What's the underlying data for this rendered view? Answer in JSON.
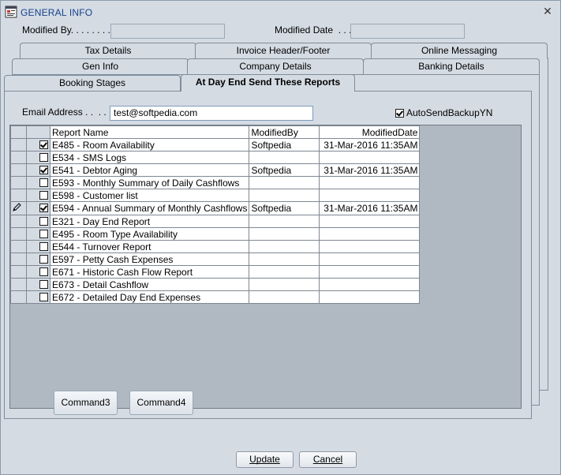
{
  "window": {
    "title": "GENERAL INFO"
  },
  "header": {
    "modified_by_label": "Modified By. . . . . . . . . .",
    "modified_by_value": "",
    "modified_date_label": "Modified Date  . . . .",
    "modified_date_value": ""
  },
  "tabs": {
    "row1": [
      "Tax Details",
      "Invoice Header/Footer",
      "Online Messaging"
    ],
    "row2": [
      "Gen Info",
      "Company Details",
      "Banking Details"
    ],
    "row3": [
      "Booking Stages",
      "At Day End Send These Reports"
    ],
    "active": "At Day End Send These Reports"
  },
  "form": {
    "email_label": "Email Address . .  . . . . .",
    "email_value": "test@softpedia.com",
    "autosend_label": "AutoSendBackupYN",
    "autosend_checked": true
  },
  "grid": {
    "columns": [
      "Report Name",
      "ModifiedBy",
      "ModifiedDate"
    ],
    "rows": [
      {
        "checked": true,
        "name": "E485 - Room Availability",
        "by": "Softpedia",
        "date": "31-Mar-2016 11:35AM"
      },
      {
        "checked": false,
        "name": "E534 - SMS Logs",
        "by": "",
        "date": ""
      },
      {
        "checked": true,
        "name": "E541 - Debtor Aging",
        "by": "Softpedia",
        "date": "31-Mar-2016 11:35AM"
      },
      {
        "checked": false,
        "name": "E593 - Monthly Summary of Daily Cashflows",
        "by": "",
        "date": ""
      },
      {
        "checked": false,
        "name": "E598 - Customer list",
        "by": "",
        "date": ""
      },
      {
        "checked": true,
        "name": "E594 - Annual Summary of Monthly Cashflows",
        "by": "Softpedia",
        "date": "31-Mar-2016 11:35AM",
        "editing": true
      },
      {
        "checked": false,
        "name": "E321 - Day End Report",
        "by": "",
        "date": ""
      },
      {
        "checked": false,
        "name": "E495 - Room Type Availability",
        "by": "",
        "date": ""
      },
      {
        "checked": false,
        "name": "E544 - Turnover Report",
        "by": "",
        "date": ""
      },
      {
        "checked": false,
        "name": "E597 - Petty Cash Expenses",
        "by": "",
        "date": ""
      },
      {
        "checked": false,
        "name": "E671 - Historic Cash Flow Report",
        "by": "",
        "date": ""
      },
      {
        "checked": false,
        "name": "E673 - Detail Cashflow",
        "by": "",
        "date": ""
      },
      {
        "checked": false,
        "name": "E672 - Detailed Day End Expenses",
        "by": "",
        "date": ""
      }
    ]
  },
  "buttons": {
    "command3": "Command3",
    "command4": "Command4",
    "update": "Update",
    "cancel": "Cancel"
  },
  "icons": {
    "app": "app-window-icon",
    "close": "close-icon",
    "edit": "pencil-icon"
  },
  "colors": {
    "title_text": "#15428b",
    "window_bg": "#d4dbe3"
  }
}
